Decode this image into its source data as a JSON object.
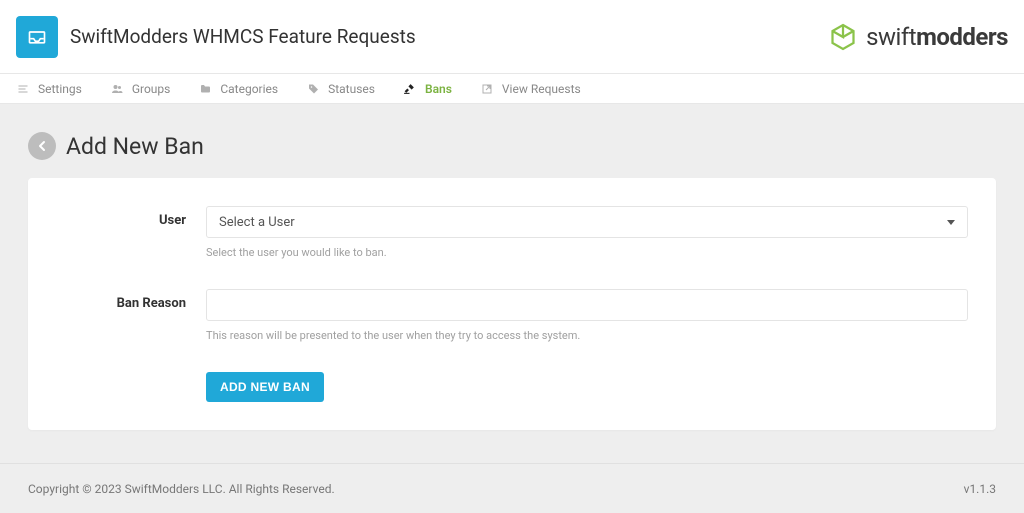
{
  "header": {
    "title": "SwiftModders WHMCS Feature Requests",
    "brand_prefix": "swift",
    "brand_suffix": "modders"
  },
  "nav": {
    "items": [
      {
        "label": "Settings",
        "icon": "menu-icon"
      },
      {
        "label": "Groups",
        "icon": "users-icon"
      },
      {
        "label": "Categories",
        "icon": "folder-icon"
      },
      {
        "label": "Statuses",
        "icon": "tag-icon"
      },
      {
        "label": "Bans",
        "icon": "gavel-icon",
        "active": true
      },
      {
        "label": "View Requests",
        "icon": "external-icon"
      }
    ]
  },
  "page": {
    "title": "Add New Ban"
  },
  "form": {
    "user": {
      "label": "User",
      "placeholder": "Select a User",
      "help": "Select the user you would like to ban."
    },
    "reason": {
      "label": "Ban Reason",
      "value": "",
      "help": "This reason will be presented to the user when they try to access the system."
    },
    "submit_label": "ADD NEW BAN"
  },
  "footer": {
    "copyright": "Copyright © 2023 SwiftModders LLC. All Rights Reserved.",
    "version": "v1.1.3"
  }
}
